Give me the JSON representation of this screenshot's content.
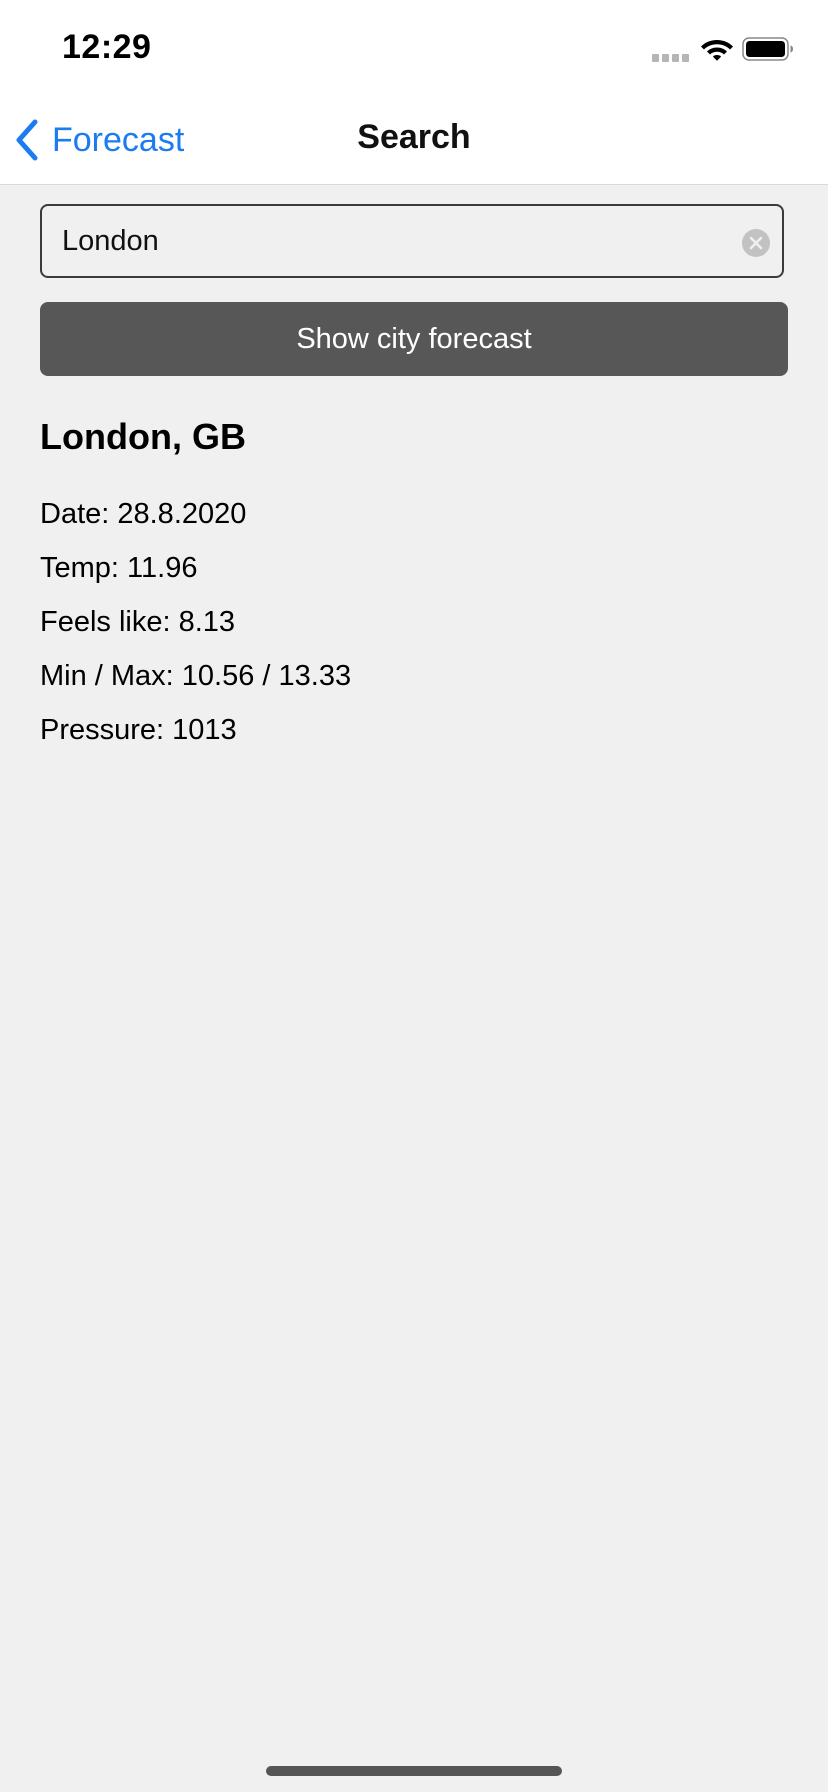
{
  "status_bar": {
    "time": "12:29"
  },
  "nav": {
    "back_label": "Forecast",
    "title": "Search"
  },
  "search": {
    "value": "London"
  },
  "action": {
    "button_label": "Show city forecast"
  },
  "result": {
    "city": "London, GB",
    "date": "Date: 28.8.2020",
    "temp": "Temp: 11.96",
    "feels_like": "Feels like: 8.13",
    "min_max": "Min / Max: 10.56 / 13.33",
    "pressure": "Pressure: 1013"
  },
  "colors": {
    "accent": "#1a7cf0",
    "button_bg": "#575757",
    "background": "#f0f0f0"
  }
}
